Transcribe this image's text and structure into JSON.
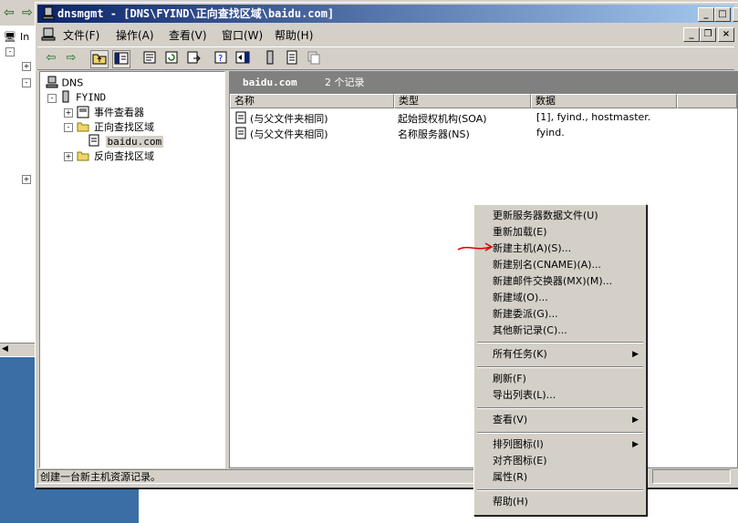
{
  "window": {
    "title": "dnsmgmt - [DNS\\FYIND\\正向查找区域\\baidu.com]",
    "controls": {
      "minimize": "_",
      "maximize": "□",
      "close": "×"
    },
    "mdi_controls": {
      "minimize": "_",
      "restore": "❐",
      "close": "×"
    }
  },
  "background_window": {
    "tree_label": "In",
    "left_arrow": "⇦",
    "right_arrow": "⇨"
  },
  "menubar": {
    "file": "文件(F)",
    "action": "操作(A)",
    "view": "查看(V)",
    "window": "窗口(W)",
    "help": "帮助(H)"
  },
  "toolbar": {
    "icons": [
      "back-icon",
      "forward-icon",
      "up-folder-icon",
      "show-tree-icon",
      "properties-icon",
      "refresh-icon",
      "export-icon",
      "help-icon",
      "action-pane-icon",
      "server-icon",
      "list-icon",
      "copy-icon"
    ]
  },
  "tree": {
    "root": "DNS",
    "server": "FYIND",
    "event_viewer": "事件查看器",
    "forward_zone": "正向查找区域",
    "zone_baidu": "baidu.com",
    "reverse_zone": "反向查找区域"
  },
  "list": {
    "zone_name": "baidu.com",
    "record_count": "2 个记录",
    "columns": {
      "name": "名称",
      "type": "类型",
      "data": "数据"
    },
    "rows": [
      {
        "name": "(与父文件夹相同)",
        "type": "起始授权机构(SOA)",
        "data": "[1], fyind., hostmaster."
      },
      {
        "name": "(与父文件夹相同)",
        "type": "名称服务器(NS)",
        "data": "fyind."
      }
    ]
  },
  "statusbar": {
    "text": "创建一台新主机资源记录。"
  },
  "context_menu": {
    "update_server_data": "更新服务器数据文件(U)",
    "reload": "重新加载(E)",
    "new_host": "新建主机(A)(S)...",
    "new_alias": "新建别名(CNAME)(A)...",
    "new_mx": "新建邮件交换器(MX)(M)...",
    "new_domain": "新建域(O)...",
    "new_delegation": "新建委派(G)...",
    "other_records": "其他新记录(C)...",
    "all_tasks": "所有任务(K)",
    "refresh": "刷新(F)",
    "export_list": "导出列表(L)...",
    "view": "查看(V)",
    "arrange_icons": "排列图标(I)",
    "line_up_icons": "对齐图标(E)",
    "properties": "属性(R)",
    "help": "帮助(H)",
    "submenu_arrow": "▶"
  },
  "colors": {
    "titlebar_start": "#0a246a",
    "titlebar_end": "#a6caf0",
    "annotation": "#e00000",
    "desktop": "#3a6ea5"
  }
}
